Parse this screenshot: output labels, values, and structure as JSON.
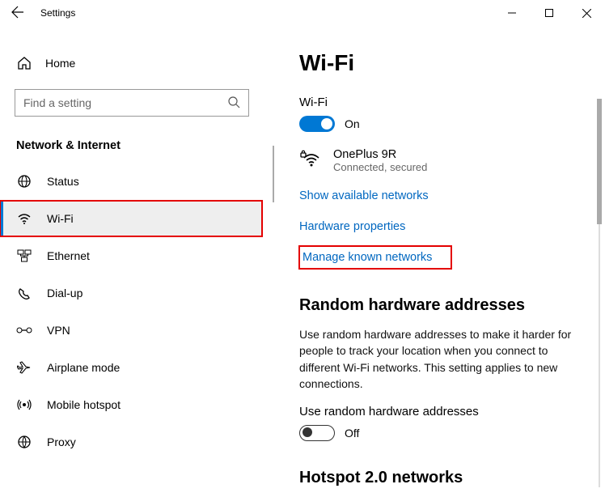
{
  "titlebar": {
    "title": "Settings"
  },
  "sidebar": {
    "home": "Home",
    "search_placeholder": "Find a setting",
    "section": "Network & Internet",
    "items": [
      {
        "label": "Status"
      },
      {
        "label": "Wi-Fi"
      },
      {
        "label": "Ethernet"
      },
      {
        "label": "Dial-up"
      },
      {
        "label": "VPN"
      },
      {
        "label": "Airplane mode"
      },
      {
        "label": "Mobile hotspot"
      },
      {
        "label": "Proxy"
      }
    ]
  },
  "main": {
    "title": "Wi-Fi",
    "wifi_label": "Wi-Fi",
    "wifi_state": "On",
    "network_name": "OnePlus 9R",
    "network_status": "Connected, secured",
    "links": {
      "show_available": "Show available networks",
      "hardware_props": "Hardware properties",
      "manage_known": "Manage known networks"
    },
    "random_heading": "Random hardware addresses",
    "random_desc": "Use random hardware addresses to make it harder for people to track your location when you connect to different Wi-Fi networks. This setting applies to new connections.",
    "random_sub": "Use random hardware addresses",
    "random_state": "Off",
    "hotspot_heading": "Hotspot 2.0 networks"
  }
}
